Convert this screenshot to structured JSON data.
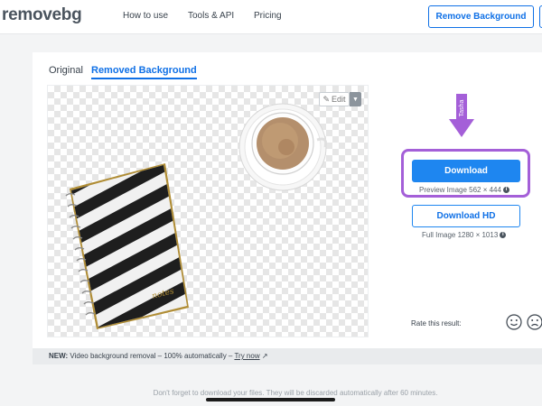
{
  "header": {
    "logo_main": "remove",
    "logo_suffix": "bg",
    "nav": [
      "How to use",
      "Tools & API",
      "Pricing"
    ],
    "cta_label": "Remove Background"
  },
  "tabs": {
    "original": "Original",
    "removed": "Removed Background"
  },
  "preview": {
    "edit_label": "Edit",
    "notebook_text": "notes"
  },
  "annotation": {
    "name": "Tasha",
    "color": "#a45fd8"
  },
  "download": {
    "label": "Download",
    "info": "Preview Image 562 × 444",
    "hd_label": "Download HD",
    "hd_info": "Full Image 1280 × 1013"
  },
  "rating": {
    "label": "Rate this result:"
  },
  "promo": {
    "prefix": "NEW:",
    "text": " Video background removal – 100% automatically – ",
    "link": "Try now"
  },
  "footer": {
    "note": "Don't forget to download your files. They will be discarded automatically after 60 minutes."
  },
  "colors": {
    "accent": "#0f70e6",
    "button": "#1e86f0",
    "highlight": "#a45fd8"
  }
}
